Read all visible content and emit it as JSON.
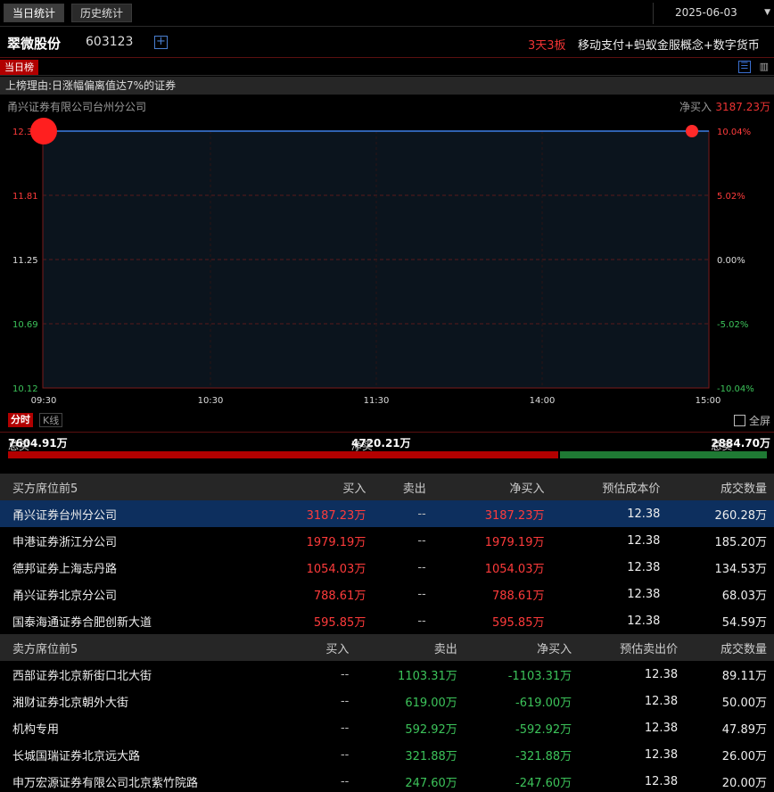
{
  "tabs": [
    "当日统计",
    "历史统计"
  ],
  "date": "2025-06-03",
  "stock": {
    "name": "翠微股份",
    "code": "603123",
    "board": "3天3板",
    "concept": "移动支付+蚂蚁金服概念+数字货币"
  },
  "list_tag": "当日榜",
  "reason": "上榜理由:日涨幅偏离值达7%的证券",
  "broker": {
    "name": "甬兴证券有限公司台州分公司",
    "net_label": "净买入",
    "net_value": "3187.23万"
  },
  "chart_data": {
    "type": "line",
    "x_ticks": [
      "09:30",
      "10:30",
      "11:30",
      "14:00",
      "15:00"
    ],
    "y_ticks_left": [
      "12.38",
      "11.81",
      "11.25",
      "10.69",
      "10.12"
    ],
    "y_ticks_right": [
      "10.04%",
      "5.02%",
      "0.00%",
      "-5.02%",
      "-10.04%"
    ],
    "ylim": [
      10.12,
      12.38
    ],
    "price_constant": 12.38,
    "grid": true,
    "marker_start_time": "09:30",
    "marker_end_time": "15:00"
  },
  "chart_modes": {
    "active": "分时",
    "other": "K线",
    "fullscreen": "全屏"
  },
  "summary": {
    "buy_label": "总买",
    "buy_value": "7604.91万",
    "net_label": "净买",
    "net_value": "4720.21万",
    "sell_label": "总卖",
    "sell_value": "2884.70万",
    "buy_ratio": 0.725
  },
  "buy_table": {
    "headers": [
      "买方席位前5",
      "买入",
      "卖出",
      "净买入",
      "预估成本价",
      "成交数量"
    ],
    "rows": [
      [
        "甬兴证券台州分公司",
        "3187.23万",
        "--",
        "3187.23万",
        "12.38",
        "260.28万"
      ],
      [
        "申港证券浙江分公司",
        "1979.19万",
        "--",
        "1979.19万",
        "12.38",
        "185.20万"
      ],
      [
        "德邦证券上海志丹路",
        "1054.03万",
        "--",
        "1054.03万",
        "12.38",
        "134.53万"
      ],
      [
        "甬兴证券北京分公司",
        "788.61万",
        "--",
        "788.61万",
        "12.38",
        "68.03万"
      ],
      [
        "国泰海通证券合肥创新大道",
        "595.85万",
        "--",
        "595.85万",
        "12.38",
        "54.59万"
      ]
    ]
  },
  "sell_table": {
    "headers": [
      "卖方席位前5",
      "买入",
      "卖出",
      "净买入",
      "预估卖出价",
      "成交数量"
    ],
    "rows": [
      [
        "西部证券北京新街口北大街",
        "--",
        "1103.31万",
        "-1103.31万",
        "12.38",
        "89.11万"
      ],
      [
        "湘财证券北京朝外大街",
        "--",
        "619.00万",
        "-619.00万",
        "12.38",
        "50.00万"
      ],
      [
        "机构专用",
        "--",
        "592.92万",
        "-592.92万",
        "12.38",
        "47.89万"
      ],
      [
        "长城国瑞证券北京远大路",
        "--",
        "321.88万",
        "-321.88万",
        "12.38",
        "26.00万"
      ],
      [
        "申万宏源证券有限公司北京紫竹院路",
        "--",
        "247.60万",
        "-247.60万",
        "12.38",
        "20.00万"
      ]
    ]
  }
}
